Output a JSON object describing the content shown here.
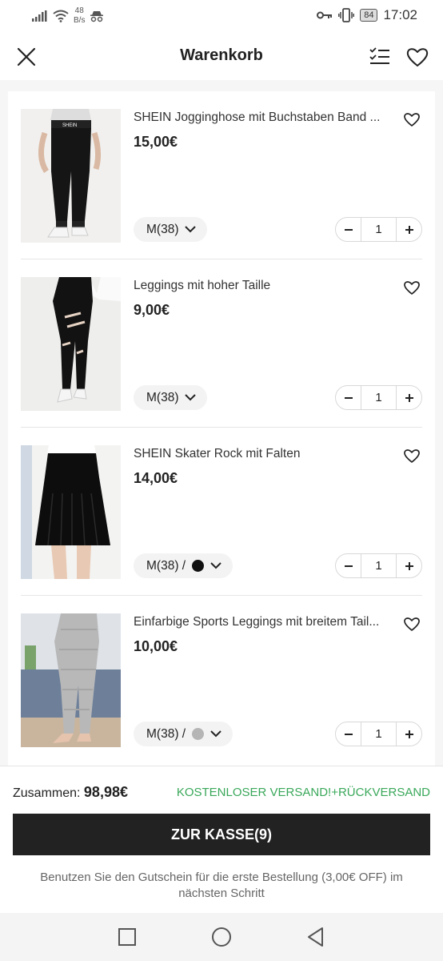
{
  "status_bar": {
    "speed_value": "48",
    "speed_unit": "B/s",
    "battery": "84",
    "time": "17:02"
  },
  "header": {
    "title": "Warenkorb"
  },
  "items": [
    {
      "name": "SHEIN Jogginghose mit Buchstaben Band ...",
      "price": "15,00€",
      "size": "M(38)",
      "quantity": "1",
      "color": null
    },
    {
      "name": "Leggings mit hoher Taille",
      "price": "9,00€",
      "size": "M(38)",
      "quantity": "1",
      "color": null
    },
    {
      "name": "SHEIN Skater Rock mit Falten",
      "price": "14,00€",
      "size": "M(38) /",
      "quantity": "1",
      "color": "#111111"
    },
    {
      "name": "Einfarbige Sports Leggings mit breitem Tail...",
      "price": "10,00€",
      "size": "M(38) /",
      "quantity": "1",
      "color": "#b5b5b5"
    }
  ],
  "summary": {
    "total_label": "Zusammen:",
    "total_value": "98,98€",
    "shipping": "KOSTENLOSER VERSAND!+RÜCKVERSAND",
    "checkout_label": "ZUR KASSE(9)",
    "coupon_text": "Benutzen Sie den Gutschein für die erste Bestellung (3,00€ OFF) im nächsten Schritt"
  },
  "colors": {
    "accent_green": "#3aa85a",
    "checkout_bg": "#222222"
  }
}
